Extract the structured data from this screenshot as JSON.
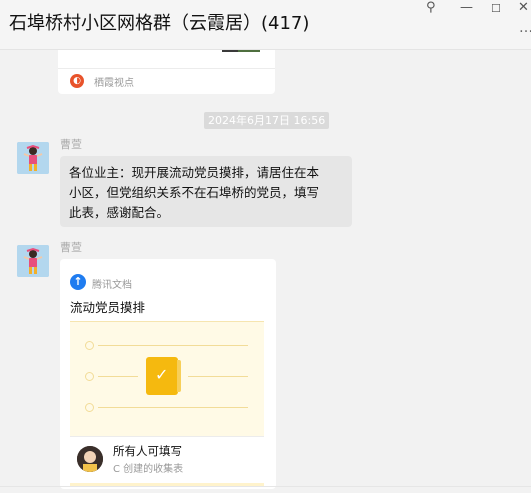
{
  "window": {
    "title": "石埠桥村小区网格群（云霞居）(417)",
    "icons": [
      "pin-icon",
      "minimize-icon",
      "maximize-icon",
      "close-icon",
      "more-icon"
    ]
  },
  "messages": {
    "prev_card": {
      "source": "栖霞视点",
      "source_icon": "source-logo-icon"
    },
    "timestamp": "2024年6月17日 16:56",
    "text_message": {
      "sender": "曹萱",
      "lines": [
        "各位业主：现开展流动党员摸排，请居住在本",
        "小区，但党组织关系不在石埠桥的党员，填写",
        "此表，感谢配合。"
      ]
    },
    "doc_message": {
      "sender": "曹萱",
      "app_name": "腾讯文档",
      "doc_title": "流动党员摸排",
      "fill_title": "所有人可填写",
      "fill_subtitle": "C 创建的收集表"
    }
  },
  "colors": {
    "background": "#f2f2f2",
    "bubble": "#e6e6e6",
    "doc_preview": "#fffae6",
    "form_icon": "#f5b90f",
    "tencent_docs_blue": "#1f7cf0",
    "avatar_bg": "#b3d7ee"
  }
}
